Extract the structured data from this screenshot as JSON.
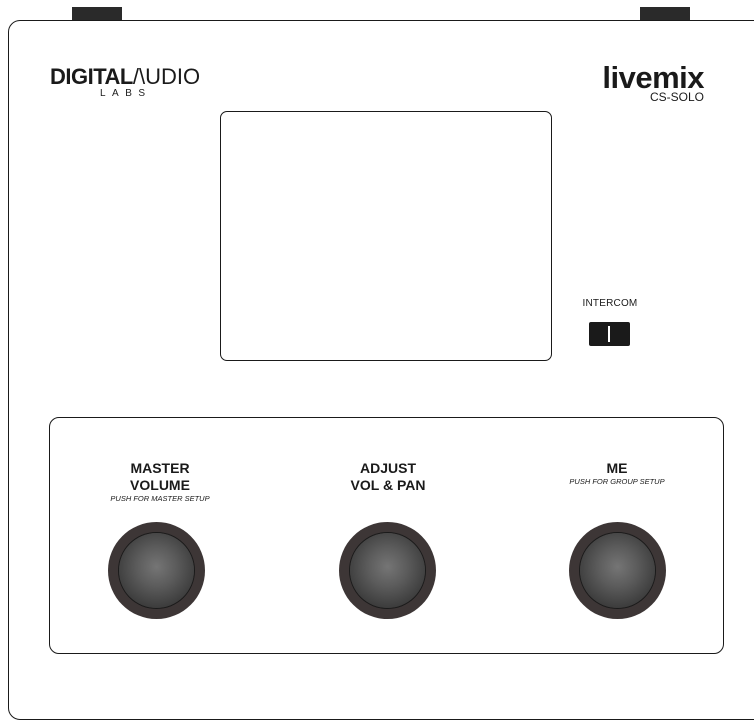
{
  "brand": {
    "main_bold": "DIGITAL",
    "main_thin": "/\\UDIO",
    "sub": "LABS"
  },
  "product": {
    "name": "livemix",
    "model": "CS-SOLO"
  },
  "intercom": {
    "label": "INTERCOM"
  },
  "knobs": [
    {
      "title_line1": "MASTER",
      "title_line2": "VOLUME",
      "subtitle": "PUSH FOR MASTER SETUP"
    },
    {
      "title_line1": "ADJUST",
      "title_line2": "VOL & PAN",
      "subtitle": ""
    },
    {
      "title_line1": "ME",
      "title_line2": "",
      "subtitle": "PUSH FOR GROUP SETUP"
    }
  ]
}
